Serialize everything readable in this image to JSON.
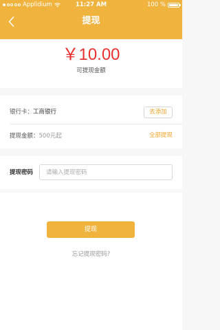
{
  "status_bar": {
    "carrier": "Applidium",
    "time": "11:27 AM",
    "battery": "100 %"
  },
  "nav": {
    "title": "提现",
    "back_icon": "chevron-left-icon"
  },
  "amount": {
    "value": "￥10.00",
    "label": "可提现金额"
  },
  "bank": {
    "label": "银行卡：",
    "value": "工商银行",
    "add_button": "去添加"
  },
  "withdraw_amount": {
    "label": "提现金额：",
    "hint": "500元起",
    "all_link": "全部提现"
  },
  "password": {
    "label": "提现密码",
    "placeholder": "请输入提现密码"
  },
  "actions": {
    "submit_label": "提现",
    "forgot_label": "忘记提现密码?"
  },
  "colors": {
    "accent": "#f0b33d",
    "amount_red": "#e8312f",
    "link_orange": "#f0a32a"
  }
}
